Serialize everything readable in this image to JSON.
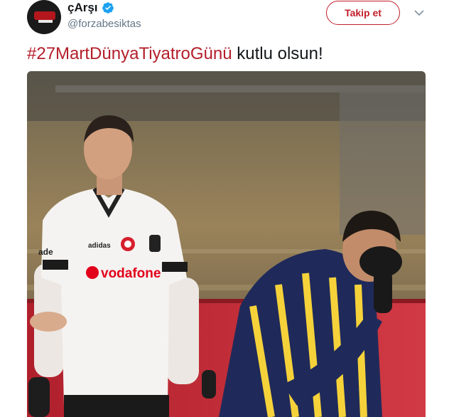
{
  "tweet": {
    "display_name": "çArşı",
    "handle": "@forzabesiktas",
    "verified": true,
    "follow_label": "Takip et",
    "hashtag": "#27MartDünyaTiyatroGünü",
    "text_rest": " kutlu olsun!",
    "link_color": "#b31e2a"
  },
  "media": {
    "left_shirt_brand": "vodafone",
    "left_sleeve_text": "adidas",
    "left_sleeve_partial": "ade"
  },
  "icons": {
    "verified": "verified-badge-icon",
    "caret": "chevron-down-icon",
    "avatar": "carsi-logo"
  }
}
